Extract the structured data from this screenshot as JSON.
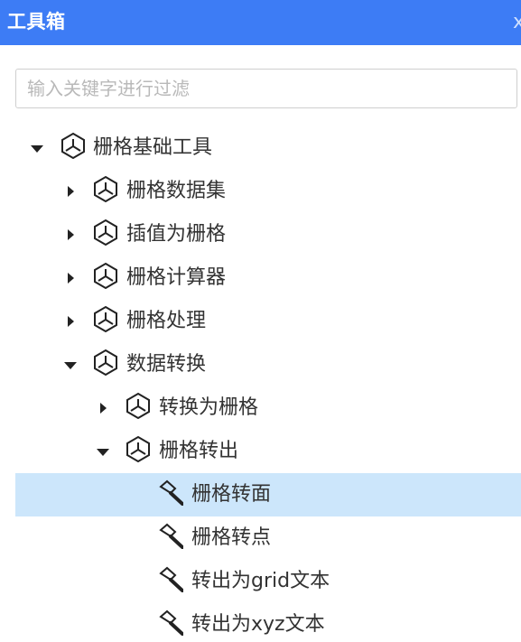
{
  "window": {
    "title": "工具箱",
    "close_label": "x"
  },
  "search": {
    "placeholder": "输入关键字进行过滤",
    "value": ""
  },
  "tree": {
    "items": [
      {
        "label": "栅格基础工具",
        "expanded": true,
        "icon": "cube-icon"
      },
      {
        "label": "栅格数据集",
        "expanded": false,
        "icon": "cube-icon"
      },
      {
        "label": "插值为栅格",
        "expanded": false,
        "icon": "cube-icon"
      },
      {
        "label": "栅格计算器",
        "expanded": false,
        "icon": "cube-icon"
      },
      {
        "label": "栅格处理",
        "expanded": false,
        "icon": "cube-icon"
      },
      {
        "label": "数据转换",
        "expanded": true,
        "icon": "cube-icon"
      },
      {
        "label": "转换为栅格",
        "expanded": false,
        "icon": "cube-icon"
      },
      {
        "label": "栅格转出",
        "expanded": true,
        "icon": "cube-icon"
      },
      {
        "label": "栅格转面",
        "selected": true,
        "icon": "hammer-icon"
      },
      {
        "label": "栅格转点",
        "icon": "hammer-icon"
      },
      {
        "label": "转出为grid文本",
        "icon": "hammer-icon"
      },
      {
        "label": "转出为xyz文本",
        "icon": "hammer-icon"
      }
    ]
  },
  "colors": {
    "titlebar": "#3d7cf5",
    "selected_row": "#cce6fb",
    "text": "#333333"
  }
}
